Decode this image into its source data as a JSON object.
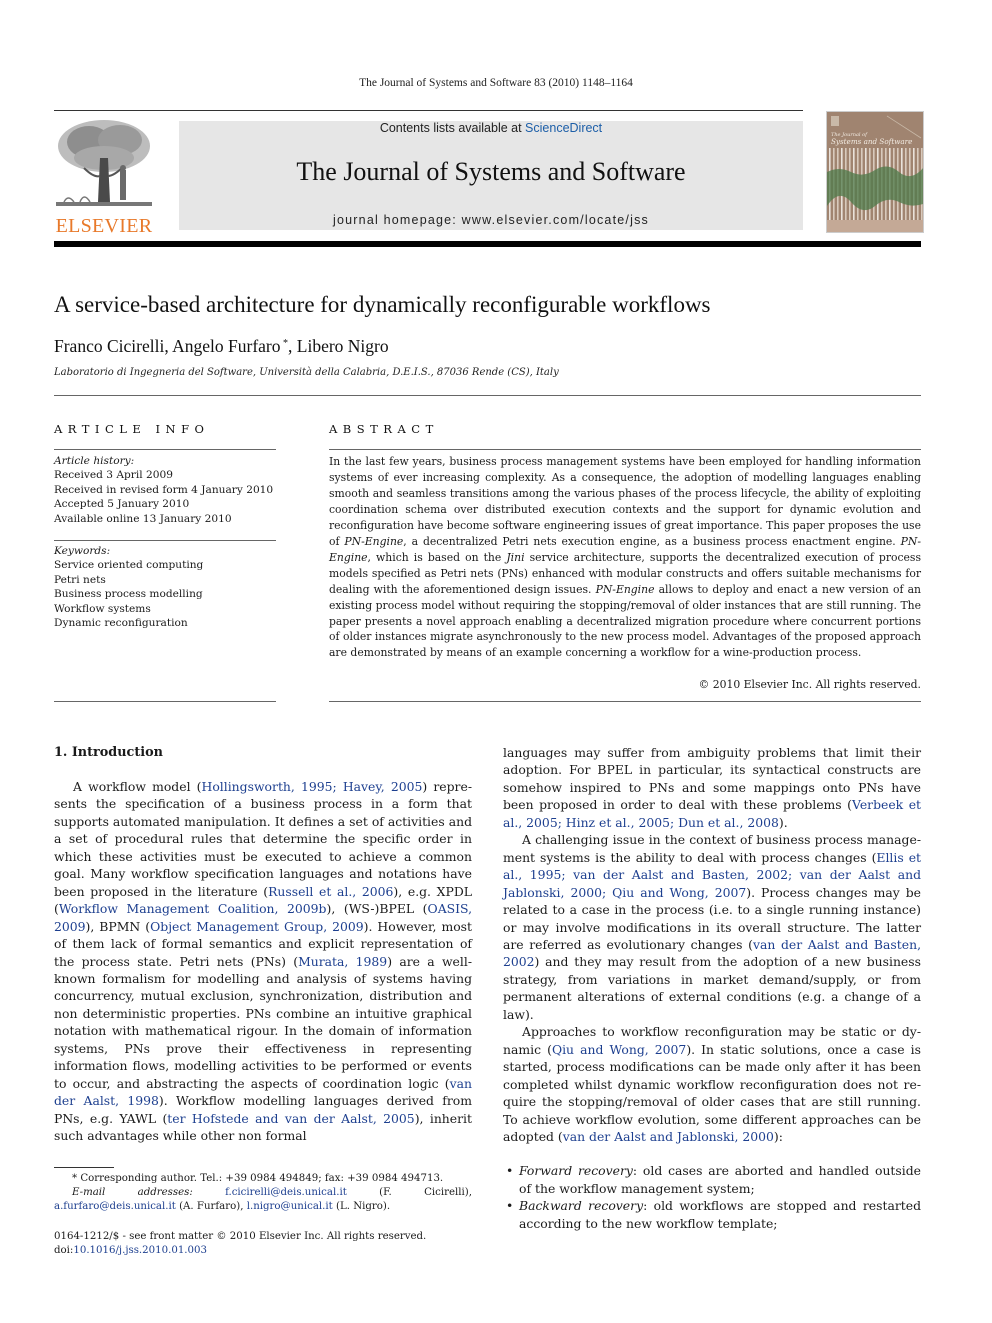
{
  "header": {
    "running_head": "The Journal of Systems and Software 83 (2010) 1148–1164",
    "publisher": "ELSEVIER",
    "contents_prefix": "Contents lists available at ",
    "contents_link": "ScienceDirect",
    "journal_title": "The Journal of Systems and Software",
    "homepage": "journal homepage: www.elsevier.com/locate/jss",
    "cover_text": "The Journal of Systems and Software",
    "colors": {
      "publisher_orange": "#e8792a",
      "link_blue": "#1d5fa8",
      "citation_blue": "#1d3f8f",
      "banner_gray": "#e6e6e6"
    }
  },
  "article": {
    "title": "A service-based architecture for dynamically reconfigurable workflows",
    "authors": [
      {
        "name": "Franco Cicirelli",
        "sep": ", "
      },
      {
        "name": "Angelo Furfaro",
        "mark": "*",
        "sep": ", "
      },
      {
        "name": "Libero Nigro",
        "sep": ""
      }
    ],
    "affiliation": "Laboratorio di Ingegneria del Software, Università della Calabria, D.E.I.S., 87036 Rende (CS), Italy"
  },
  "article_info": {
    "heading": "ARTICLE INFO",
    "history_label": "Article history:",
    "history": [
      "Received 3 April 2009",
      "Received in revised form 4 January 2010",
      "Accepted 5 January 2010",
      "Available online 13 January 2010"
    ],
    "keywords_label": "Keywords:",
    "keywords": [
      "Service oriented computing",
      "Petri nets",
      "Business process modelling",
      "Workflow systems",
      "Dynamic reconfiguration"
    ]
  },
  "abstract": {
    "heading": "ABSTRACT",
    "segments": [
      {
        "t": "In the last few years, business process management systems have been employed for handling informa­tion systems of ever increasing complexity. As a consequence, the adoption of modelling languages enabling smooth and seamless transitions among the various phases of the process lifecycle, the ability of exploiting coordination schema over distributed execution contexts and the support for dynamic evo­lution and reconfiguration have become software engineering issues of great importance. This paper pro­poses the use of "
      },
      {
        "t": "PN-Engine",
        "i": true
      },
      {
        "t": ", a decentralized Petri nets execution engine, as a business process enactment engine. "
      },
      {
        "t": "PN-Engine",
        "i": true
      },
      {
        "t": ", which is based on the "
      },
      {
        "t": "Jini",
        "i": true
      },
      {
        "t": " service architecture, supports the decentralized execution of process models specified as Petri nets (PNs) enhanced with modular constructs and offers suitable mech­anisms for dealing with the aforementioned design issues. "
      },
      {
        "t": "PN-Engine",
        "i": true
      },
      {
        "t": " allows to deploy and enact a new version of an existing process model without requiring the stopping/removal of older instances that are still running. The paper presents a novel approach enabling a decentralized migration procedure where concurrent portions of older instances migrate asynchronously to the new process model. Advan­tages of the proposed approach are demonstrated by means of an example concerning a workflow for a wine-production process."
      }
    ],
    "copyright": "© 2010 Elsevier Inc. All rights reserved."
  },
  "body": {
    "section_heading": "1. Introduction",
    "left_paragraphs": [
      [
        {
          "t": "A workflow model ("
        },
        {
          "t": "Hollingsworth, 1995; Havey, 2005",
          "c": true
        },
        {
          "t": ") repre­sents the specification of a business process in a form that supports automated manipulation. It defines a set of activities and a set of procedural rules that determine the specific order in which these activities must be executed to achieve a common goal. Many work­flow specification languages and notations have been proposed in the literature ("
        },
        {
          "t": "Russell et al., 2006",
          "c": true
        },
        {
          "t": "), e.g. XPDL ("
        },
        {
          "t": "Workflow Manage­ment Coalition, 2009b",
          "c": true
        },
        {
          "t": "), (WS-)BPEL ("
        },
        {
          "t": "OASIS, 2009",
          "c": true
        },
        {
          "t": "), BPMN ("
        },
        {
          "t": "Object Management Group, 2009",
          "c": true
        },
        {
          "t": "). However, most of them lack of formal semantics and explicit representation of the process state. Petri nets (PNs) ("
        },
        {
          "t": "Murata, 1989",
          "c": true
        },
        {
          "t": ") are a well-known formalism for model­ling and analysis of systems having concurrency, mutual exclusion, synchronization, distribution and non deterministic properties. PNs combine an intuitive graphical notation with mathematical rigour. In the domain of information systems, PNs prove their effectiveness in representing information flows, modelling activi­ties to be performed or events to occur, and abstracting the aspects of coordination logic ("
        },
        {
          "t": "van der Aalst, 1998",
          "c": true
        },
        {
          "t": "). Workflow modelling languages derived from PNs, e.g. YAWL ("
        },
        {
          "t": "ter Hofstede and van der Aalst, 2005",
          "c": true
        },
        {
          "t": "), inherit such advantages while other non formal"
        }
      ]
    ],
    "right_paragraphs": [
      [
        {
          "t": "languages may suffer from ambiguity problems that limit their adoption. For BPEL in particular, its syntactical constructs are somehow inspired to PNs and some mappings onto PNs have been proposed in order to deal with these problems ("
        },
        {
          "t": "Verbeek et al., 2005; Hinz et al., 2005; Dun et al., 2008",
          "c": true
        },
        {
          "t": ")."
        }
      ],
      [
        {
          "t": "A challenging issue in the context of business process manage­ment systems is the ability to deal with process changes ("
        },
        {
          "t": "Ellis et al., 1995; van der Aalst and Basten, 2002; van der Aalst and Jablonski, 2000; Qiu and Wong, 2007",
          "c": true
        },
        {
          "t": "). Process changes may be related to a case in the process (i.e. to a single running instance) or may involve modifications in its overall structure. The latter are referred as evo­lutionary changes ("
        },
        {
          "t": "van der Aalst and Basten, 2002",
          "c": true
        },
        {
          "t": ") and they may result from the adoption of a new business strategy, from varia­tions in market demand/supply, or from permanent alterations of external conditions (e.g. a change of a law)."
        }
      ],
      [
        {
          "t": "Approaches to workflow reconfiguration may be static or dy­namic ("
        },
        {
          "t": "Qiu and Wong, 2007",
          "c": true
        },
        {
          "t": "). In static solutions, once a case is started, process modifications can be made only after it has been completed whilst dynamic workflow reconfiguration does not re­quire the stopping/removal of older cases that are still running. To achieve workflow evolution, some different approaches can be adopted ("
        },
        {
          "t": "van der Aalst and Jablonski, 2000",
          "c": true
        },
        {
          "t": "):"
        }
      ]
    ],
    "bullets": [
      {
        "term": "Forward recovery",
        "text": ": old cases are aborted and handled outside of the workflow management system;"
      },
      {
        "term": "Backward recovery",
        "text": ": old workflows are stopped and restarted according to the new workflow template;"
      }
    ]
  },
  "footnotes": {
    "corresponding": "* Corresponding author. Tel.: +39 0984 494849; fax: +39 0984 494713.",
    "email_label": "E-mail addresses:",
    "emails": [
      {
        "addr": "f.cicirelli@deis.unical.it",
        "who": " (F. Cicirelli), "
      },
      {
        "addr": "a.furfaro@deis.unical.it",
        "who": " (A. Furfaro), "
      },
      {
        "addr": "l.nigro@unical.it",
        "who": " (L. Nigro)."
      }
    ],
    "issn": "0164-1212/$ - see front matter © 2010 Elsevier Inc. All rights reserved.",
    "doi_prefix": "doi:",
    "doi": "10.1016/j.jss.2010.01.003"
  }
}
